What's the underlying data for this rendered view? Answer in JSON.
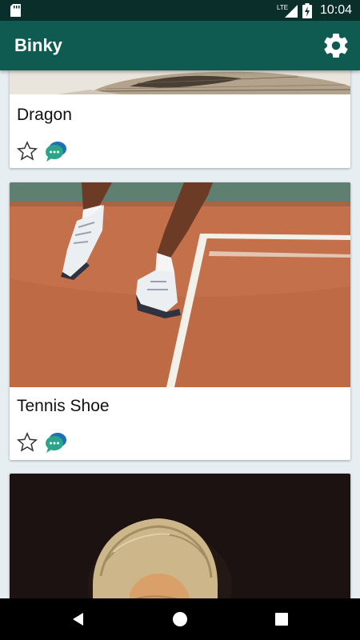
{
  "status_bar": {
    "time": "10:04",
    "network": "LTE",
    "icons": [
      "sd-card-icon",
      "signal-icon",
      "battery-charging-icon"
    ]
  },
  "app_bar": {
    "title": "Binky",
    "settings_icon": "gear-icon"
  },
  "feed": {
    "cards": [
      {
        "title": "Dragon",
        "image": "engraved illustration (cropped top)",
        "actions": [
          "star-icon",
          "chat-bubbles-icon"
        ]
      },
      {
        "title": "Tennis Shoe",
        "image": "tennis player feet on clay court",
        "actions": [
          "star-icon",
          "chat-bubbles-icon"
        ]
      },
      {
        "title": "",
        "image": "portrait painting of figure in bonnet",
        "actions": []
      }
    ]
  },
  "nav_bar": {
    "buttons": [
      "back-icon",
      "home-icon",
      "recents-icon"
    ]
  },
  "colors": {
    "status_bar": "#0a2e2a",
    "app_bar": "#0f5b52",
    "background": "#e6eef2",
    "clay_court": "#c9714a"
  }
}
